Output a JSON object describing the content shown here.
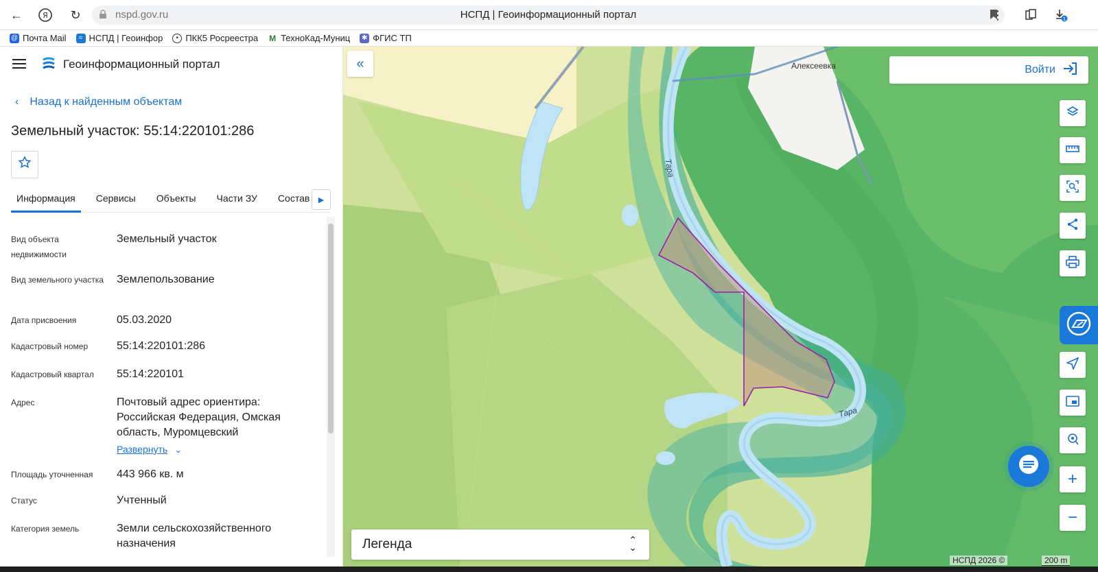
{
  "browser": {
    "url": "nspd.gov.ru",
    "tab_title": "НСПД | Геоинформационный портал",
    "bookmarks": [
      {
        "label": "Почта Mail",
        "icon": "mail-icon",
        "color": "#1e63e9"
      },
      {
        "label": "НСПД | Геоинфор",
        "icon": "nspd-icon",
        "color": "#1a78d8"
      },
      {
        "label": "ПКК5 Росреестра",
        "icon": "location-pin-icon",
        "color": "#333333"
      },
      {
        "label": "ТехноКад-Муниц",
        "icon": "technokad-icon",
        "color": "#2e7d32"
      },
      {
        "label": "ФГИС ТП",
        "icon": "fgis-icon",
        "color": "#5c6bc0"
      }
    ]
  },
  "panel": {
    "portal_name": "Геоинформационный портал",
    "back_label": "Назад к найденным объектам",
    "title": "Земельный участок: 55:14:220101:286",
    "tabs": [
      "Информация",
      "Сервисы",
      "Объекты",
      "Части ЗУ",
      "Состав"
    ],
    "active_tab": "Информация",
    "info": [
      {
        "label": "Вид объекта недвижимости",
        "value": "Земельный участок"
      },
      {
        "label": "Вид земельного участка",
        "value": "Землепользование"
      },
      {
        "label": "Дата присвоения",
        "value": "05.03.2020"
      },
      {
        "label": "Кадастровый номер",
        "value": "55:14:220101:286"
      },
      {
        "label": "Кадастровый квартал",
        "value": "55:14:220101"
      },
      {
        "label": "Адрес",
        "value": "Почтовый адрес ориентира: Российская Федерация, Омская область, Муромцевский"
      },
      {
        "label": "Площадь уточненная",
        "value": "443 966 кв. м"
      },
      {
        "label": "Статус",
        "value": "Учтенный"
      },
      {
        "label": "Категория земель",
        "value": "Земли сельскохозяйственного назначения"
      }
    ],
    "expand_label": "Развернуть"
  },
  "map": {
    "login_label": "Войти",
    "legend_label": "Легенда",
    "copyright": "НСПД 2026 ©",
    "scale": "200 m",
    "village": "Алексеевка",
    "river_label_1": "Тара",
    "river_label_2": "Тара",
    "tools": [
      "layers-icon",
      "ruler-icon",
      "select-area-icon",
      "share-icon",
      "print-icon",
      "navigate-icon",
      "frame-icon",
      "location-search-icon",
      "zoom-in-icon",
      "zoom-out-icon"
    ],
    "colors": {
      "accent": "#1a6fd8",
      "parcel_border": "#9b1fa8",
      "forest": "#5dbb6a",
      "river": "#bfe4f6"
    }
  }
}
